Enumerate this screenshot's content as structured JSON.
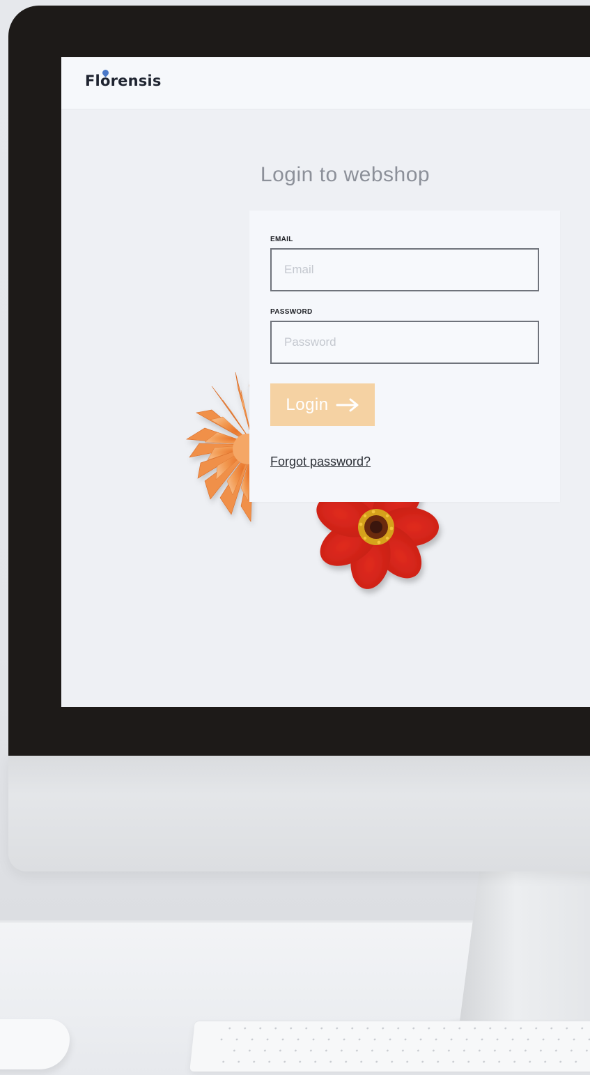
{
  "app": {
    "brand": "Florensis"
  },
  "login": {
    "title": "Login to webshop",
    "email_label": "EMAIL",
    "email_placeholder": "Email",
    "email_value": "",
    "password_label": "PASSWORD",
    "password_placeholder": "Password",
    "password_value": "",
    "submit_label": "Login",
    "forgot_link": "Forgot password?"
  },
  "colors": {
    "accent": "#f5d2a3",
    "bezel": "#1d1a18",
    "screen_bg": "#eef0f4",
    "text_dark": "#1f2430"
  },
  "icons": {
    "submit_icon": "arrow-right-icon",
    "logo_mark": "droplet-icon"
  }
}
